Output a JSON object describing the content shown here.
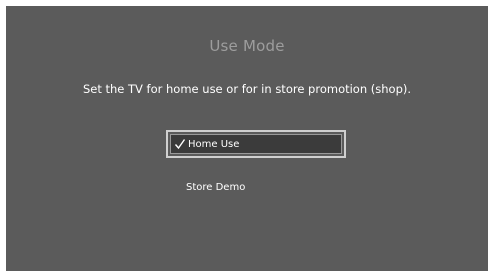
{
  "dialog": {
    "title": "Use Mode",
    "subtitle": "Set the TV for home use or for in store promotion (shop)."
  },
  "options": [
    {
      "label": "Home Use",
      "selected": true,
      "icon": "checkmark-icon"
    },
    {
      "label": "Store Demo",
      "selected": false
    }
  ]
}
